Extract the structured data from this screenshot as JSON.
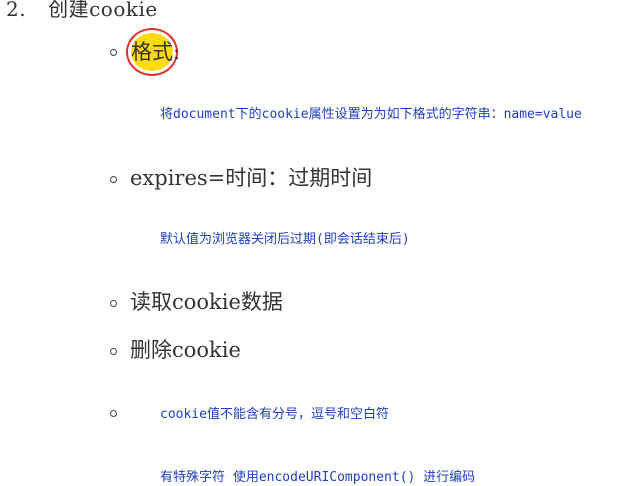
{
  "section": {
    "number": "2.",
    "title": "创建cookie"
  },
  "items": [
    {
      "label": "格式:",
      "note": "将document下的cookie属性设置为为如下格式的字符串：name=value"
    },
    {
      "label": "expires=时间：过期时间",
      "note": "默认值为浏览器关闭后过期(即会话结束后)"
    },
    {
      "label": "读取cookie数据"
    },
    {
      "label": "删除cookie"
    },
    {
      "label": "",
      "note": "cookie值不能含有分号，逗号和空白符",
      "note2": "有特殊字符 使用encodeURIComponent() 进行编码"
    }
  ],
  "colors": {
    "note_text": "#1f3fbf",
    "cursor_highlight": "#ffd800",
    "cursor_ring": "#e0302a"
  }
}
